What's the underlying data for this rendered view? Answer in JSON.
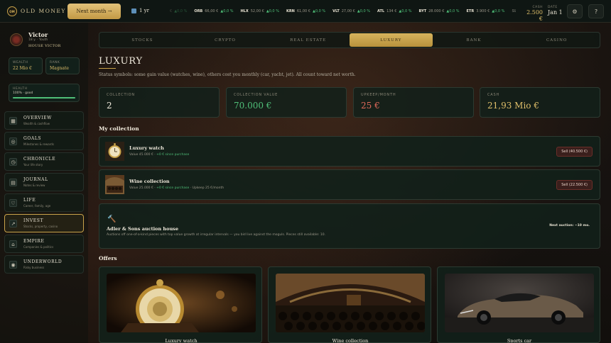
{
  "app": {
    "logo_badge": "OM",
    "logo_text": "OLD MONEY"
  },
  "topbar": {
    "next_button": "Next month →",
    "speed": "1 yr",
    "tickers": [
      {
        "sym": "",
        "price": "€",
        "chg": "▲0,0 %",
        "fade": true
      },
      {
        "sym": "ORB",
        "price": "66,00 €",
        "chg": "▲0,0 %"
      },
      {
        "sym": "HLX",
        "price": "52,00 €",
        "chg": "▲0,0 %"
      },
      {
        "sym": "KRN",
        "price": "61,00 €",
        "chg": "▲0,0 %"
      },
      {
        "sym": "VLT",
        "price": "27,00 €",
        "chg": "▲0,0 %"
      },
      {
        "sym": "ATL",
        "price": "134 €",
        "chg": "▲0,0 %"
      },
      {
        "sym": "BYT",
        "price": "28.000 €",
        "chg": "▲0,0 %"
      },
      {
        "sym": "ETR",
        "price": "3.900 €",
        "chg": "▲0,0 %"
      },
      {
        "sym": "SLV",
        "price": "",
        "chg": "",
        "fade": true
      }
    ],
    "cash_label": "CASH",
    "cash_value": "2.500 €",
    "date_label": "DATE",
    "date_value": "Jan 1",
    "settings_icon": "gear-icon",
    "help_icon": "help-icon",
    "help_glyph": "?",
    "settings_glyph": "⚙"
  },
  "profile": {
    "name": "Victor",
    "meta": "18 y. · Youth",
    "house": "HOUSE VICTOR",
    "wealth_label": "WEALTH",
    "wealth_value": "22 Mio €",
    "rank_label": "RANK",
    "rank_value": "Magnate",
    "health_label": "HEALTH",
    "health_text": "100% · good",
    "health_fraction": 1.0
  },
  "nav": [
    {
      "title": "OVERVIEW",
      "sub": "Wealth & cashflow",
      "icon": "grid-icon",
      "glyph": "▦"
    },
    {
      "title": "GOALS",
      "sub": "Milestones & rewards",
      "icon": "target-icon",
      "glyph": "◎"
    },
    {
      "title": "CHRONICLE",
      "sub": "Your life story",
      "icon": "clock-icon",
      "glyph": "◷"
    },
    {
      "title": "JOURNAL",
      "sub": "Notes & review",
      "icon": "journal-icon",
      "glyph": "▤"
    },
    {
      "title": "LIFE",
      "sub": "Career, family, age",
      "icon": "heart-icon",
      "glyph": "♡"
    },
    {
      "title": "INVEST",
      "sub": "Stocks, property, casino",
      "icon": "trend-icon",
      "glyph": "↗",
      "active": true
    },
    {
      "title": "EMPIRE",
      "sub": "Companies & politics",
      "icon": "empire-icon",
      "glyph": "⌂"
    },
    {
      "title": "UNDERWORLD",
      "sub": "Risky business",
      "icon": "underworld-icon",
      "glyph": "◉"
    }
  ],
  "tabs": [
    {
      "label": "STOCKS"
    },
    {
      "label": "CRYPTO"
    },
    {
      "label": "REAL ESTATE"
    },
    {
      "label": "LUXURY",
      "active": true
    },
    {
      "label": "BANK"
    },
    {
      "label": "CASINO"
    }
  ],
  "page": {
    "title": "LUXURY",
    "description": "Status symbols: some gain value (watches, wine), others cost you monthly (car, yacht, jet). All count toward net worth."
  },
  "kpis": [
    {
      "label": "COLLECTION",
      "value": "2",
      "color": "#f0eadc"
    },
    {
      "label": "COLLECTION VALUE",
      "value": "70.000 €",
      "color": "#4fbf78"
    },
    {
      "label": "UPKEEP/MONTH",
      "value": "25 €",
      "color": "#e06a5a"
    },
    {
      "label": "CASH",
      "value": "21,93 Mio €",
      "color": "#e0bf6a"
    }
  ],
  "collection": {
    "title": "My collection",
    "items": [
      {
        "name": "Luxury watch",
        "value_text": "Value 45.000 € · ",
        "gain_text": "+0 € since purchase",
        "extra": "",
        "sell": "Sell (40.500 €)",
        "thumb": "watch"
      },
      {
        "name": "Wine collection",
        "value_text": "Value 25.000 € · ",
        "gain_text": "+0 € since purchase",
        "extra": " · Upkeep 25 €/month",
        "sell": "Sell (22.500 €)",
        "thumb": "wine"
      }
    ]
  },
  "auction": {
    "icon": "hammer-icon",
    "glyph": "🔨",
    "title": "Adler & Sons auction house",
    "description": "Auctions off one-of-a-kind pieces with top value growth at irregular intervals — you bid live against the moguls. Pieces still available: 10.",
    "next": "Next auction: ~10 mo."
  },
  "offers": {
    "title": "Offers",
    "items": [
      {
        "name": "Luxury watch",
        "img": "watch"
      },
      {
        "name": "Wine collection",
        "img": "wine"
      },
      {
        "name": "Sports car",
        "img": "car"
      }
    ]
  }
}
